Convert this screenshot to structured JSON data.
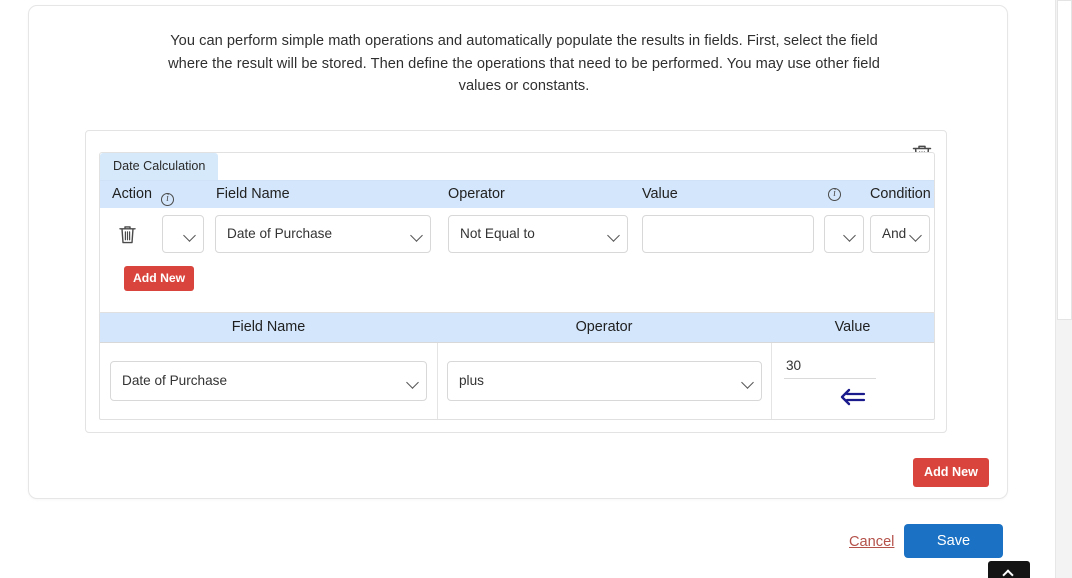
{
  "intro": {
    "text": "You can perform simple math operations and automatically populate the results in fields. First, select the field where the result will be stored. Then define the operations that need to be performed. You may use other field values or constants."
  },
  "panel": {
    "delete_icon": "trash-icon",
    "tab": {
      "label": "Date Calculation"
    },
    "condition_table": {
      "headers": {
        "action": "Action",
        "action_info": "info-icon",
        "field_name": "Field Name",
        "operator": "Operator",
        "value": "Value",
        "value_info": "info-icon",
        "condition": "Condition"
      },
      "rows": [
        {
          "delete_icon": "trash-icon",
          "action_select": {
            "value": "",
            "chevron": "chevron-down-icon"
          },
          "field_select": {
            "value": "Date of Purchase",
            "chevron": "chevron-down-icon"
          },
          "operator_select": {
            "value": "Not Equal to",
            "chevron": "chevron-down-icon"
          },
          "value_input": {
            "value": "",
            "placeholder": ""
          },
          "value_select": {
            "value": "",
            "chevron": "chevron-down-icon"
          },
          "condition_select": {
            "value": "And",
            "chevron": "chevron-down-icon"
          }
        }
      ],
      "add_new_label": "Add New"
    },
    "operations_table": {
      "headers": {
        "field_name": "Field Name",
        "operator": "Operator",
        "value": "Value"
      },
      "rows": [
        {
          "field_select": {
            "value": "Date of Purchase",
            "chevron": "chevron-down-icon"
          },
          "operator_select": {
            "value": "plus",
            "chevron": "chevron-down-icon"
          },
          "value_input": {
            "value": "30",
            "placeholder": ""
          },
          "insert_icon": "arrow-left-from-line-icon"
        }
      ]
    }
  },
  "actions": {
    "add_new_label": "Add New"
  },
  "footer": {
    "cancel_label": "Cancel",
    "save_label": "Save"
  },
  "colors": {
    "header_band": "#d3e6fb",
    "tab_bg": "#d6e9fa",
    "danger": "#d9453c",
    "primary": "#1b72c4",
    "cancel_link": "#b4524a",
    "insert_arrow": "#1a1a8c"
  }
}
